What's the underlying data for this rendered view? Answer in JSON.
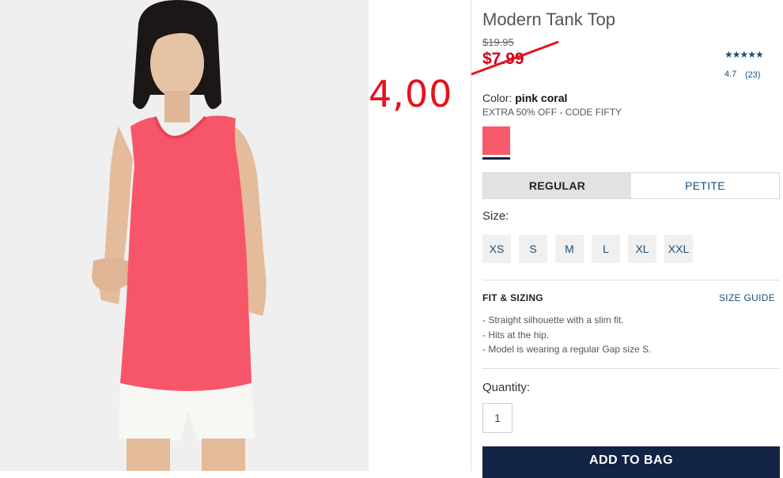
{
  "product": {
    "title": "Modern Tank Top",
    "price_original": "$19.95",
    "price_sale": "$7.99",
    "annotation_price": "4,00",
    "rating_stars": "★★★★★",
    "rating_value": "4.7",
    "rating_count": "(23)"
  },
  "color": {
    "label": "Color:",
    "name": "pink coral",
    "promo": "EXTRA 50% OFF - CODE FIFTY",
    "swatch_hex": "#f75b6b"
  },
  "fit": {
    "tabs": [
      "REGULAR",
      "PETITE"
    ],
    "selected": "REGULAR"
  },
  "size": {
    "label": "Size:",
    "options": [
      "XS",
      "S",
      "M",
      "L",
      "XL",
      "XXL"
    ]
  },
  "fit_sizing": {
    "title": "FIT & SIZING",
    "guide_link": "SIZE GUIDE",
    "bullets": [
      "- Straight silhouette with a slim fit.",
      "- Hits at the hip.",
      "- Model is wearing a regular Gap size S."
    ]
  },
  "quantity": {
    "label": "Quantity:",
    "value": "1"
  },
  "cta": {
    "add_to_bag": "ADD TO BAG"
  },
  "colors": {
    "brand_navy": "#122345",
    "link_blue": "#1b4f79",
    "sale_red": "#d0021b",
    "annotation_red": "#e8101a"
  }
}
